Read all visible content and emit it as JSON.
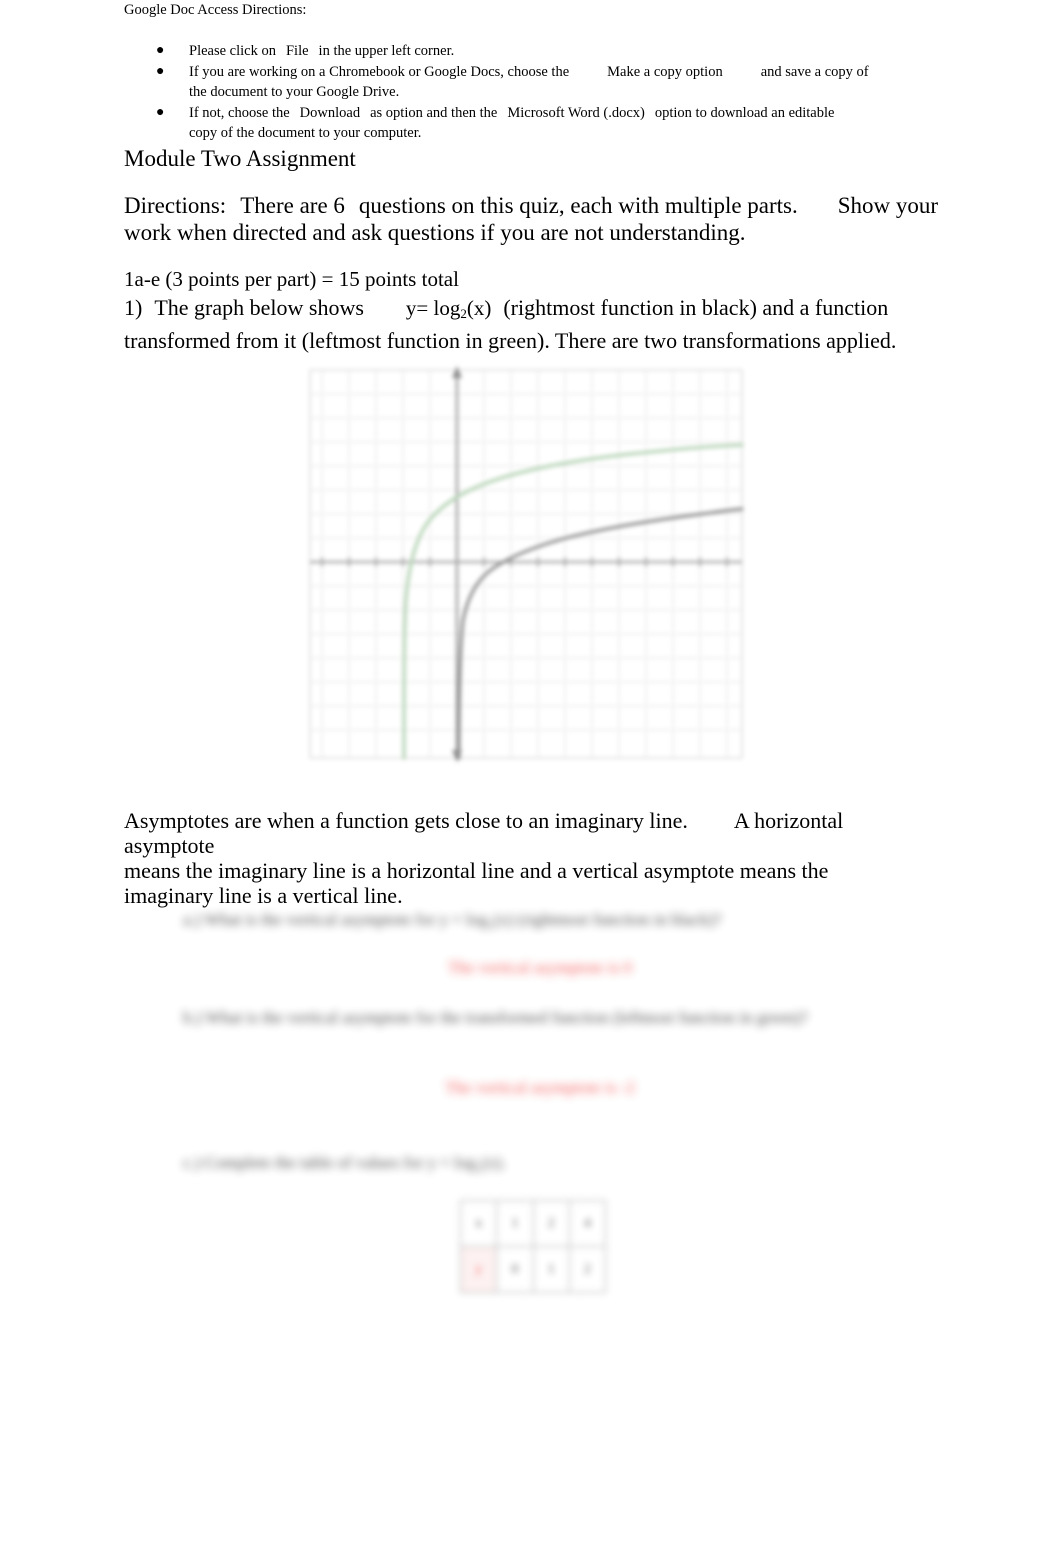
{
  "document": {
    "access_heading": "Google Doc Access Directions:",
    "title": "Module Two Assignment"
  },
  "access_bullets": [
    {
      "bullet_glyph": "●",
      "part1": "Please click on",
      "emphasis": "File",
      "part2": "in the upper left corner.",
      "part3": ""
    },
    {
      "bullet_glyph": "●",
      "part1": "If you are working on a Chromebook or Google Docs, choose the",
      "emphasis": "Make a copy option",
      "part2": "and save a copy of",
      "part3": "the document to your Google Drive."
    },
    {
      "bullet_glyph": "●",
      "part1": "If not, choose the",
      "emphasis": "Download",
      "part2": "as option and then the",
      "emphasis2": "Microsoft Word (.docx)",
      "part3": "option to download an editable",
      "part4": "copy of the document to your computer."
    }
  ],
  "directions": {
    "label": "Directions:",
    "text_a": "There are 6",
    "text_b": "questions on this quiz, each with multiple parts.",
    "text_c": "Show your",
    "text_d": "work when directed and ask questions if you are not understanding."
  },
  "points_line": "1a-e (3 points per part) = 15 points total",
  "question_1": {
    "number": "1)",
    "text_a": "The graph below shows",
    "function_prefix": "y=",
    "function_name": "log",
    "function_base": "2",
    "function_arg": "(x)",
    "text_b": "(rightmost function in black) and a function",
    "text_c": "transformed from it (leftmost function in green). There are two transformations applied."
  },
  "asymptote_para": {
    "sentence_1": "Asymptotes are when a function gets close to an imaginary line.",
    "sentence_2": "A horizontal asymptote",
    "sentence_3": "means the imaginary line is a horizontal line and a vertical asymptote means the",
    "sentence_4": "imaginary line is a vertical line."
  },
  "sub_questions": [
    {
      "id": "a",
      "prompt": "a.) What is the vertical asymptote for   y = log₂(x)   (rightmost function in black)?",
      "answer": "The vertical asymptote is 0",
      "answer_color": "#f0312f"
    },
    {
      "id": "b",
      "prompt": "b.) What is the vertical asymptote for the transformed function (leftmost function in green)?",
      "answer": "The vertical asymptote is -2",
      "answer_color": "#f0312f"
    },
    {
      "id": "c",
      "prompt": "c.) Complete the table of values for   y = log₂(x).",
      "answer": "",
      "answer_color": ""
    }
  ],
  "value_table": {
    "rows": [
      [
        "x",
        "1",
        "2",
        "4"
      ],
      [
        "y",
        "0",
        "1",
        "2"
      ]
    ],
    "highlight_cell": {
      "row": 1,
      "col": 0
    },
    "highlight_color": "#f0312f"
  },
  "chart_data": {
    "type": "line",
    "title": "",
    "xlabel": "",
    "ylabel": "",
    "xlim": [
      -6,
      10
    ],
    "ylim": [
      -6,
      6
    ],
    "grid": true,
    "legend": "none",
    "series": [
      {
        "name": "y = log2(x)",
        "color": "#7a7a7a",
        "description": "rightmost function in black, vertical asymptote at x = 0",
        "points": [
          [
            0.25,
            -2
          ],
          [
            0.5,
            -1
          ],
          [
            1,
            0
          ],
          [
            2,
            1
          ],
          [
            3,
            1.58
          ],
          [
            4,
            2
          ],
          [
            5,
            2.32
          ],
          [
            6,
            2.58
          ],
          [
            7,
            2.81
          ],
          [
            8,
            3
          ],
          [
            9,
            3.17
          ],
          [
            10,
            3.32
          ]
        ]
      },
      {
        "name": "transformed function",
        "color": "#aecfae",
        "description": "leftmost function in green, vertical asymptote at x = -2, shifted up",
        "points": [
          [
            -1.75,
            -2
          ],
          [
            -1.5,
            -1
          ],
          [
            -1,
            0
          ],
          [
            -1,
            1.2
          ],
          [
            0,
            2.2
          ],
          [
            1,
            2.8
          ],
          [
            2,
            3.2
          ],
          [
            3,
            3.5
          ],
          [
            4,
            3.7
          ],
          [
            5,
            3.85
          ],
          [
            6,
            3.95
          ],
          [
            7,
            4.05
          ],
          [
            8,
            4.12
          ],
          [
            9,
            4.18
          ],
          [
            10,
            4.22
          ]
        ]
      }
    ]
  }
}
